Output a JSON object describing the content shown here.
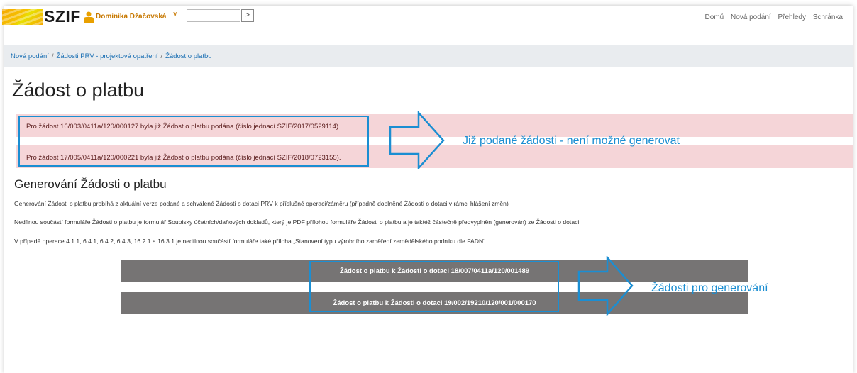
{
  "header": {
    "logo_text": "SZIF",
    "user_name": "Dominika Džačovská",
    "search_value": "",
    "search_button_label": ">",
    "nav": [
      "Domů",
      "Nová podání",
      "Přehledy",
      "Schránka"
    ]
  },
  "breadcrumb": [
    "Nová podání",
    "Žádosti PRV - projektová opatření",
    "Žádost o platbu"
  ],
  "page_title": "Žádost o platbu",
  "alerts": [
    "Pro žádost 16/003/0411a/120/000127 byla již Žádost o platbu podána (číslo jednací SZIF/2017/0529114).",
    "Pro žádost 17/005/0411a/120/000221 byla již Žádost o platbu podána (číslo jednací SZIF/2018/0723155)."
  ],
  "annotations": {
    "submitted": "Již podané žádosti - není možné generovat",
    "to_generate": "Žádosti pro generování"
  },
  "section": {
    "title": "Generování Žádosti o platbu",
    "paragraphs": [
      "Generování Žádosti o platbu probíhá z aktuální verze podané a schválené Žádosti o dotaci PRV k příslušné operaci/záměru (případně doplněné Žádosti o dotaci v rámci hlášení změn)",
      "Nedílnou součástí formuláře Žádosti o platbu je formulář Soupisky účetních/daňových dokladů, který je PDF přílohou formuláře Žádosti o platbu a je taktéž částečně předvyplněn (generován) ze Žádosti o dotaci.",
      "V případě operace 4.1.1, 6.4.1, 6.4.2, 6.4.3, 16.2.1 a 16.3.1 je nedílnou součástí formuláře také příloha „Stanovení typu výrobního zaměření zemědělského podniku dle FADN“."
    ]
  },
  "buttons": [
    "Žádost o platbu k Žádosti o dotaci 18/007/0411a/120/001489",
    "Žádost o platbu k Žádosti o dotaci 19/002/19210/120/001/000170"
  ],
  "colors": {
    "accent": "#1b8ed2",
    "alert_bg": "#f5d5d8",
    "button_bg": "#767474",
    "user": "#c77800"
  }
}
